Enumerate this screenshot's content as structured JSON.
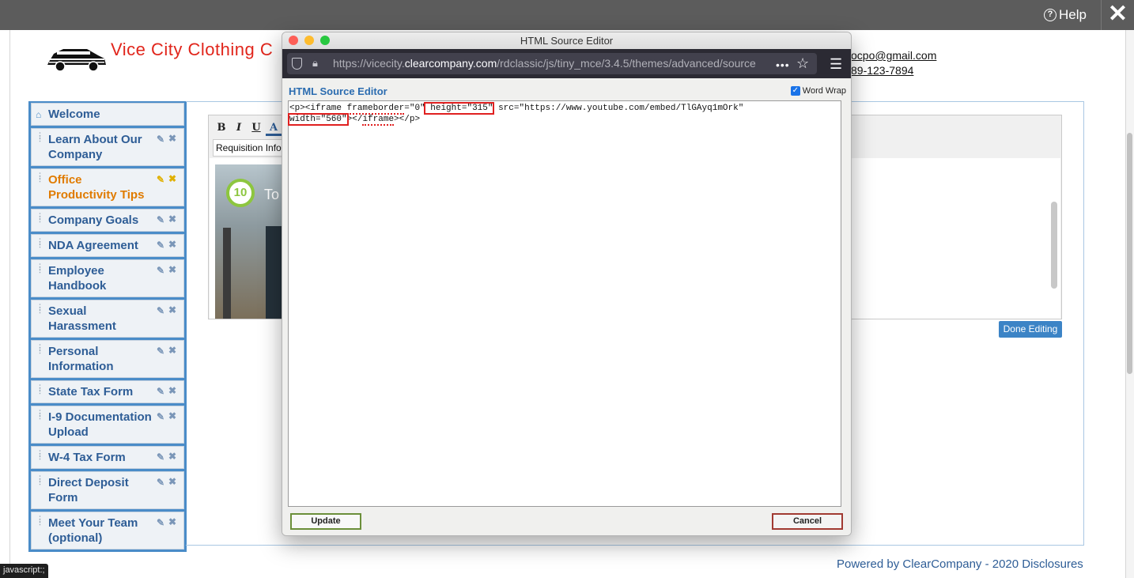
{
  "header": {
    "help_label": "Help",
    "close_label": "✕"
  },
  "company": {
    "name": "Vice City Clothing C",
    "email": "ocpo@gmail.com",
    "phone": "89-123-7894"
  },
  "sidebar": {
    "items": [
      {
        "label": "Welcome"
      },
      {
        "label": "Learn About Our Company"
      },
      {
        "label": "Office Productivity Tips"
      },
      {
        "label": "Company Goals"
      },
      {
        "label": "NDA Agreement"
      },
      {
        "label": "Employee Handbook"
      },
      {
        "label": "Sexual Harassment"
      },
      {
        "label": "Personal Information"
      },
      {
        "label": "State Tax Form"
      },
      {
        "label": "I-9 Documentation Upload"
      },
      {
        "label": "W-4 Tax Form"
      },
      {
        "label": "Direct Deposit Form"
      },
      {
        "label": "Meet Your Team (optional)"
      }
    ]
  },
  "editor": {
    "toolbar": {
      "bold": "B",
      "italic": "I",
      "underline": "U",
      "color": "A"
    },
    "template_select": "Requisition Info",
    "video_badge": "10",
    "video_text": "To",
    "done_label": "Done Editing"
  },
  "footer": {
    "powered": "Powered by ClearCompany - 2020 Disclosures",
    "status": "javascript:;"
  },
  "popup": {
    "window_title": "HTML Source Editor",
    "url_prefix": "https://vicecity.",
    "url_domain": "clearcompany.com",
    "url_path": "/rdclassic/js/tiny_mce/3.4.5/themes/advanced/source",
    "url_more": "•••",
    "heading": "HTML Source Editor",
    "word_wrap_label": "Word Wrap",
    "code": {
      "l1_a": "<p><",
      "l1_iframe": "iframe",
      "l1_b": " ",
      "l1_fb": "frameborder",
      "l1_c": "=\"0\"",
      "l1_height": " height=\"315\"",
      "l1_src": " src=\"https://www.youtube.com/embed/TlGAyq1mOrk\"",
      "l2_width": "width=\"560\"",
      "l2_a": "></",
      "l2_iframe": "iframe",
      "l2_b": "></p>"
    },
    "update_label": "Update",
    "cancel_label": "Cancel"
  }
}
